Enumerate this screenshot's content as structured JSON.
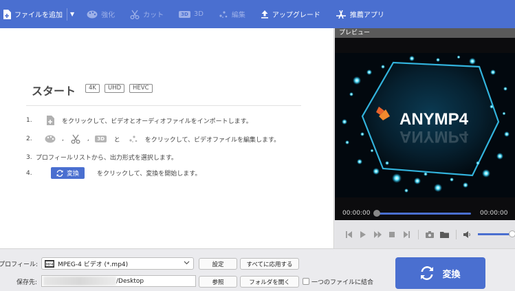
{
  "toolbar": {
    "add_file": "ファイルを追加",
    "enhance": "強化",
    "cut": "カット",
    "three_d_icon": "3D",
    "three_d": "3D",
    "edit": "編集",
    "upgrade": "アップグレード",
    "recommended_apps": "推薦アプリ"
  },
  "start": {
    "title": "スタート",
    "badges": [
      "4K",
      "UHD",
      "HEVC"
    ],
    "steps": [
      {
        "num": "1.",
        "text": "をクリックして、ビデオとオーディオファイルをインポートします。"
      },
      {
        "num": "2.",
        "sep1": ",",
        "sep2": ",",
        "and": "と",
        "icon_3d": "3D",
        "text": "をクリックして、ビデオファイルを編集します。"
      },
      {
        "num": "3.",
        "text": "プロフィールリストから、出力形式を選択します。"
      },
      {
        "num": "4.",
        "button": "変換",
        "text": "をクリックして、変換を開始します。"
      }
    ]
  },
  "preview": {
    "header": "プレビュー",
    "logo_text": "ANYMP4",
    "time_current": "00:00:00",
    "time_total": "00:00:00",
    "seek_progress": 0,
    "volume_level": 1.0
  },
  "bottom": {
    "profile_label": "プロフィール:",
    "profile_value": "MPEG-4 ビデオ (*.mp4)",
    "settings": "設定",
    "apply_all": "すべてに応用する",
    "save_label": "保存先:",
    "save_path": "/Desktop",
    "browse": "参照",
    "open_folder": "フォルダを開く",
    "merge": "一つのファイルに結合",
    "convert": "変換"
  },
  "colors": {
    "accent": "#4a6fd0",
    "toolbar": "#4a6fd0",
    "preview_bg": "#0c0c0e",
    "glow": "#29d4ff"
  }
}
